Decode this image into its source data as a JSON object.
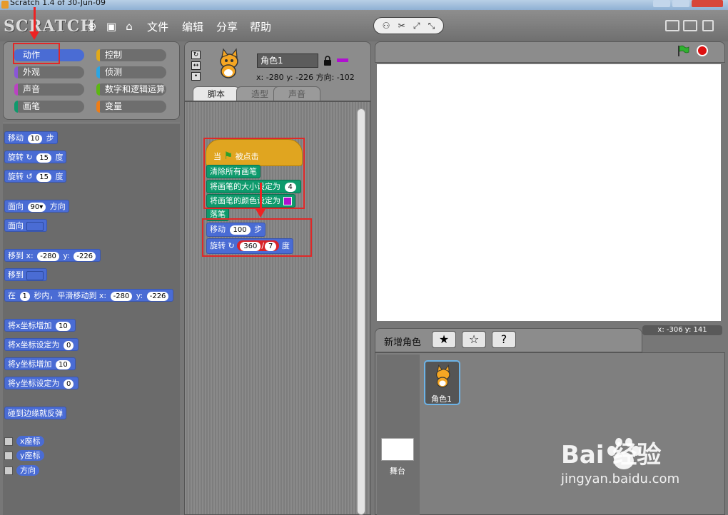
{
  "window": {
    "title": "Scratch 1.4 of 30-Jun-09"
  },
  "menubar": {
    "logo": "SCRATCH",
    "items": [
      "文件",
      "编辑",
      "分享",
      "帮助"
    ]
  },
  "categories": [
    {
      "label": "动作",
      "selected": true
    },
    {
      "label": "控制"
    },
    {
      "label": "外观"
    },
    {
      "label": "侦测"
    },
    {
      "label": "声音"
    },
    {
      "label": "数字和逻辑运算"
    },
    {
      "label": "画笔"
    },
    {
      "label": "变量"
    }
  ],
  "palette": {
    "move": {
      "pre": "移动",
      "num": "10",
      "post": "步"
    },
    "turn_cw": {
      "pre": "旋转",
      "num": "15",
      "post": "度"
    },
    "turn_ccw": {
      "pre": "旋转",
      "num": "15",
      "post": "度"
    },
    "point_dir": {
      "pre": "面向",
      "num": "90▾",
      "post": "方向"
    },
    "point_towards": {
      "pre": "面向"
    },
    "goto_xy": {
      "pre": "移到 x:",
      "x": "-280",
      "mid": "y:",
      "y": "-226"
    },
    "goto": {
      "pre": "移到"
    },
    "glide": {
      "pre": "在",
      "secs": "1",
      "mid": "秒内，平滑移动到 x:",
      "x": "-280",
      "ylabel": "y:",
      "y": "-226"
    },
    "change_x": {
      "pre": "将x坐标增加",
      "num": "10"
    },
    "set_x": {
      "pre": "将x坐标设定为",
      "num": "0"
    },
    "change_y": {
      "pre": "将y坐标增加",
      "num": "10"
    },
    "set_y": {
      "pre": "将y坐标设定为",
      "num": "0"
    },
    "bounce": {
      "label": "碰到边缘就反弹"
    },
    "reporters": [
      "x座标",
      "y座标",
      "方向"
    ]
  },
  "sprite": {
    "name": "角色1",
    "x_label": "x:",
    "x": "-280",
    "y_label": "y:",
    "y": "-226",
    "dir_label": "方向:",
    "dir": "-102",
    "pen_color": "#b010d0"
  },
  "tabs": [
    "脚本",
    "造型",
    "声音"
  ],
  "script": {
    "hat": {
      "pre": "当",
      "post": "被点击"
    },
    "clear": "清除所有画笔",
    "set_size": {
      "pre": "将画笔的大小设定为",
      "num": "4"
    },
    "set_color": {
      "pre": "将画笔的颜色设定为"
    },
    "pen_down": "落笔",
    "move": {
      "pre": "移动",
      "num": "100",
      "post": "步"
    },
    "turn": {
      "pre": "旋转",
      "a": "360",
      "op": "/",
      "b": "7",
      "post": "度"
    }
  },
  "stage": {
    "status_x": "x: -306",
    "status_y": "y: 141"
  },
  "sprite_area": {
    "new_sprite_label": "新增角色",
    "stage_label": "舞台",
    "sprite_label": "角色1"
  },
  "watermark": {
    "brand": "Bai  经验",
    "url": "jingyan.baidu.com"
  },
  "colors": {
    "motion": "#4a6cd4",
    "control": "#e1a91a",
    "pen": "#0e9a6c",
    "annotation": "#e22222"
  }
}
